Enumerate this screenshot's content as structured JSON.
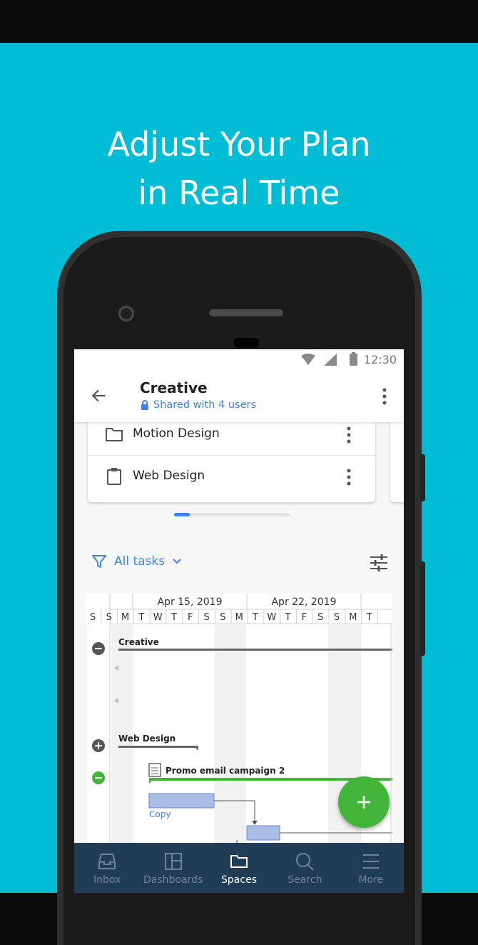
{
  "headline": {
    "line1": "Adjust Your Plan",
    "line2": "in Real Time"
  },
  "status_bar": {
    "time": "12:30"
  },
  "app_bar": {
    "title": "Creative",
    "subtitle": "Shared with 4 users"
  },
  "list": [
    {
      "label": "Motion Design",
      "icon": "folder-icon"
    },
    {
      "label": "Web Design",
      "icon": "clipboard-icon"
    }
  ],
  "filter": {
    "label": "All tasks"
  },
  "gantt": {
    "weeks": [
      "Apr 15, 2019",
      "Apr 22, 2019"
    ],
    "day_letters": [
      "S",
      "S",
      "M",
      "T",
      "W",
      "T",
      "F",
      "S",
      "S",
      "M",
      "T",
      "W",
      "T",
      "F",
      "S",
      "S",
      "M",
      "T"
    ],
    "rows": [
      {
        "label": "Creative"
      },
      {
        "label": "Web Design"
      },
      {
        "label": "Promo email campaign 2"
      },
      {
        "label": "Copy"
      }
    ]
  },
  "bottom_nav": [
    {
      "label": "Inbox",
      "icon": "inbox-icon"
    },
    {
      "label": "Dashboards",
      "icon": "dashboards-icon"
    },
    {
      "label": "Spaces",
      "icon": "spaces-icon",
      "active": true
    },
    {
      "label": "Search",
      "icon": "search-icon"
    },
    {
      "label": "More",
      "icon": "menu-icon"
    }
  ],
  "colors": {
    "background": "#00bcd4",
    "accent": "#3f83e6",
    "fab": "#43b53a",
    "navbar": "#213c55"
  }
}
